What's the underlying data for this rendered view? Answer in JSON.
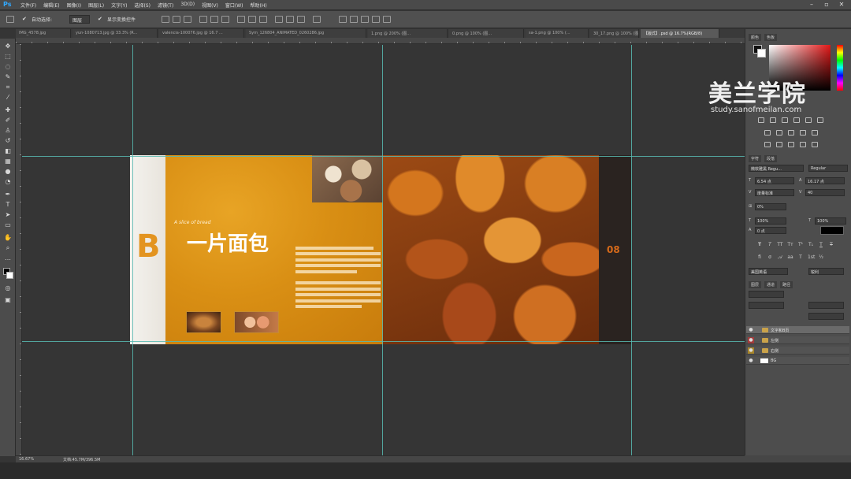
{
  "app": {
    "logo": "Ps"
  },
  "menu": [
    "文件(F)",
    "编辑(E)",
    "图像(I)",
    "图层(L)",
    "文字(Y)",
    "选择(S)",
    "滤镜(T)",
    "3D(D)",
    "视图(V)",
    "窗口(W)",
    "帮助(H)"
  ],
  "window_controls": {
    "minimize": "–",
    "restore": "▫",
    "close": "✕"
  },
  "options": {
    "auto_select_label": "自动选择:",
    "auto_select_value": "图层",
    "show_transform_label": "显示变换控件"
  },
  "tabs": [
    {
      "label": "IMG_4578.jpg",
      "active": false
    },
    {
      "label": "yun-1080713.jpg @ 33.3% (R...",
      "active": false
    },
    {
      "label": "valencia-100076.jpg @ 16.7 ...",
      "active": false
    },
    {
      "label": "Sym_126804_ANIMATED_0260286.jpg",
      "active": false
    },
    {
      "label": "1.png @ 200% (图...",
      "active": false
    },
    {
      "label": "0.png @ 100% (图...",
      "active": false
    },
    {
      "label": "sa-1.png @ 100% (...",
      "active": false
    },
    {
      "label": "30_17.png @ 100% (图...",
      "active": false
    },
    {
      "label": "【版式】.psd @ 16.7%(RGB/8)",
      "active": true
    }
  ],
  "artboard": {
    "big_letter": "B",
    "subtitle": "A slice of bread",
    "title": "一片面包",
    "page_number": "08"
  },
  "watermark": {
    "title": "美兰学院",
    "url": "study.sanofmeilan.com"
  },
  "character_panel": {
    "font_family": "微软雅黑 Regu...",
    "font_style": "Regular",
    "size": "6.54 点",
    "leading": "(自动)",
    "leading_alt": "16.17 点",
    "kerning": "度量标准",
    "tracking": "40",
    "vertical_scale": "0%",
    "horizontal_scale_a": "100%",
    "horizontal_scale_b": "100%",
    "baseline": "0 点",
    "language": "美国英语",
    "aa": "锐利"
  },
  "panel_tabs": {
    "color": "颜色",
    "swatches": "色板",
    "character": "字符",
    "paragraph": "段落",
    "layers": "图层",
    "channels": "通道",
    "paths": "路径"
  },
  "layers": [
    {
      "name": "文字和B页",
      "visible": true,
      "type": "folder",
      "selected": true,
      "marker": ""
    },
    {
      "name": "左侧",
      "visible": true,
      "type": "folder",
      "selected": false,
      "marker": "red"
    },
    {
      "name": "右侧",
      "visible": true,
      "type": "folder",
      "selected": false,
      "marker": "gold"
    },
    {
      "name": "BG",
      "visible": true,
      "type": "layer",
      "selected": false,
      "marker": ""
    }
  ],
  "status": {
    "zoom": "16.67%",
    "doc": "文档:45.7M/396.5M"
  }
}
